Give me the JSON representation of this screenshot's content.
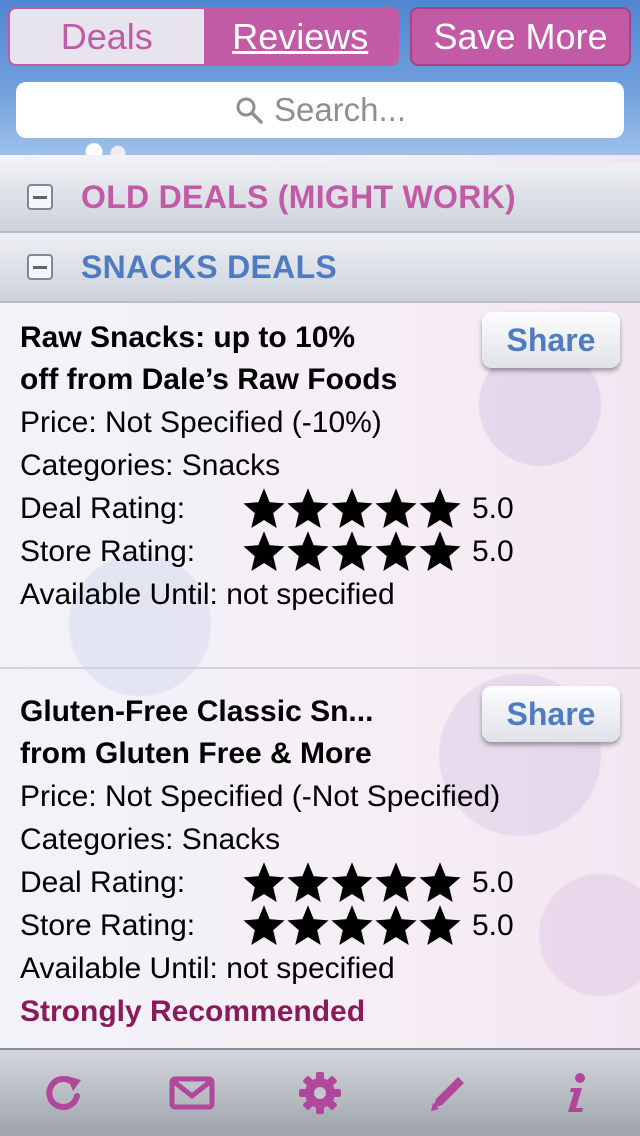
{
  "header": {
    "segments": [
      "Deals",
      "Reviews"
    ],
    "active_segment": "Reviews",
    "save_more_label": "Save More"
  },
  "search": {
    "placeholder": "Search..."
  },
  "sections": [
    {
      "title": "OLD DEALS (MIGHT WORK)",
      "expanded": true
    },
    {
      "title": "SNACKS DEALS",
      "expanded": true
    }
  ],
  "deals": [
    {
      "name_line1": "Raw Snacks: up to 10%",
      "name_line2": "off from Dale’s Raw Foods",
      "share_label": "Share",
      "price": "Price: Not Specified (-10%)",
      "categories": "Categories: Snacks",
      "deal_rating_label": "Deal Rating:",
      "deal_rating": "5.0",
      "deal_rating_stars": 5,
      "store_rating_label": "Store Rating:",
      "store_rating": "5.0",
      "store_rating_stars": 5,
      "available": "Available Until: not specified"
    },
    {
      "name_line1": "Gluten-Free Classic Sn...",
      "name_line2": "from Gluten Free & More",
      "share_label": "Share",
      "price": "Price: Not Specified (-Not Specified)",
      "categories": "Categories: Snacks",
      "deal_rating_label": "Deal Rating:",
      "deal_rating": "5.0",
      "deal_rating_stars": 5,
      "store_rating_label": "Store Rating:",
      "store_rating": "5.0",
      "store_rating_stars": 5,
      "available": "Available Until: not specified",
      "recommendation": "Strongly Recommended"
    }
  ],
  "tabbar": {
    "icons": [
      "refresh-icon",
      "mail-icon",
      "gear-icon",
      "pencil-icon",
      "info-icon"
    ]
  },
  "colors": {
    "accent_pink": "#c35aa5",
    "accent_blue": "#4f7cc0",
    "header_blue": "#4f86cf",
    "recommend": "#8b1a5a"
  }
}
